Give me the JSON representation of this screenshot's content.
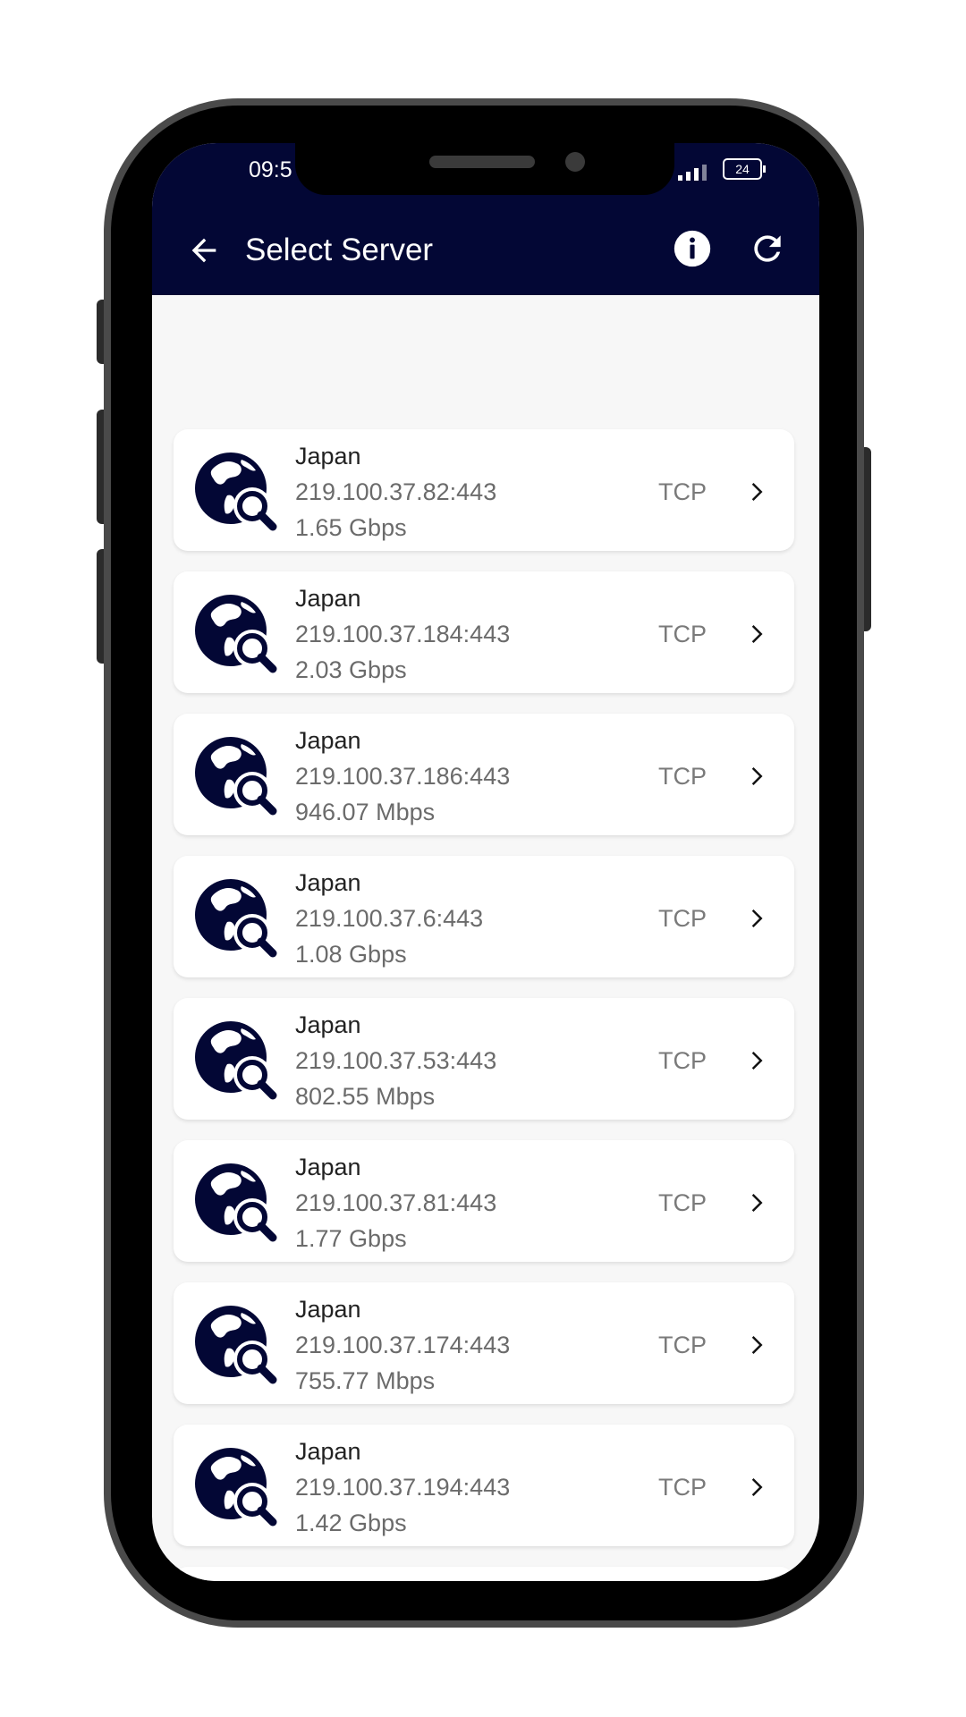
{
  "status": {
    "time": "09:5",
    "battery": "24"
  },
  "header": {
    "title": "Select Server"
  },
  "colors": {
    "header_bg": "#030735",
    "icon_navy": "#030735"
  },
  "icons": {
    "back": "arrow-left-icon",
    "info": "info-icon",
    "refresh": "refresh-icon",
    "server": "globe-search-icon",
    "open": "chevron-right-icon"
  },
  "servers": [
    {
      "country": "Japan",
      "ip": "219.100.37.82:443",
      "speed": "1.65 Gbps",
      "protocol": "TCP"
    },
    {
      "country": "Japan",
      "ip": "219.100.37.184:443",
      "speed": "2.03 Gbps",
      "protocol": "TCP"
    },
    {
      "country": "Japan",
      "ip": "219.100.37.186:443",
      "speed": "946.07 Mbps",
      "protocol": "TCP"
    },
    {
      "country": "Japan",
      "ip": "219.100.37.6:443",
      "speed": "1.08 Gbps",
      "protocol": "TCP"
    },
    {
      "country": "Japan",
      "ip": "219.100.37.53:443",
      "speed": "802.55 Mbps",
      "protocol": "TCP"
    },
    {
      "country": "Japan",
      "ip": "219.100.37.81:443",
      "speed": "1.77 Gbps",
      "protocol": "TCP"
    },
    {
      "country": "Japan",
      "ip": "219.100.37.174:443",
      "speed": "755.77 Mbps",
      "protocol": "TCP"
    },
    {
      "country": "Japan",
      "ip": "219.100.37.194:443",
      "speed": "1.42 Gbps",
      "protocol": "TCP"
    }
  ]
}
